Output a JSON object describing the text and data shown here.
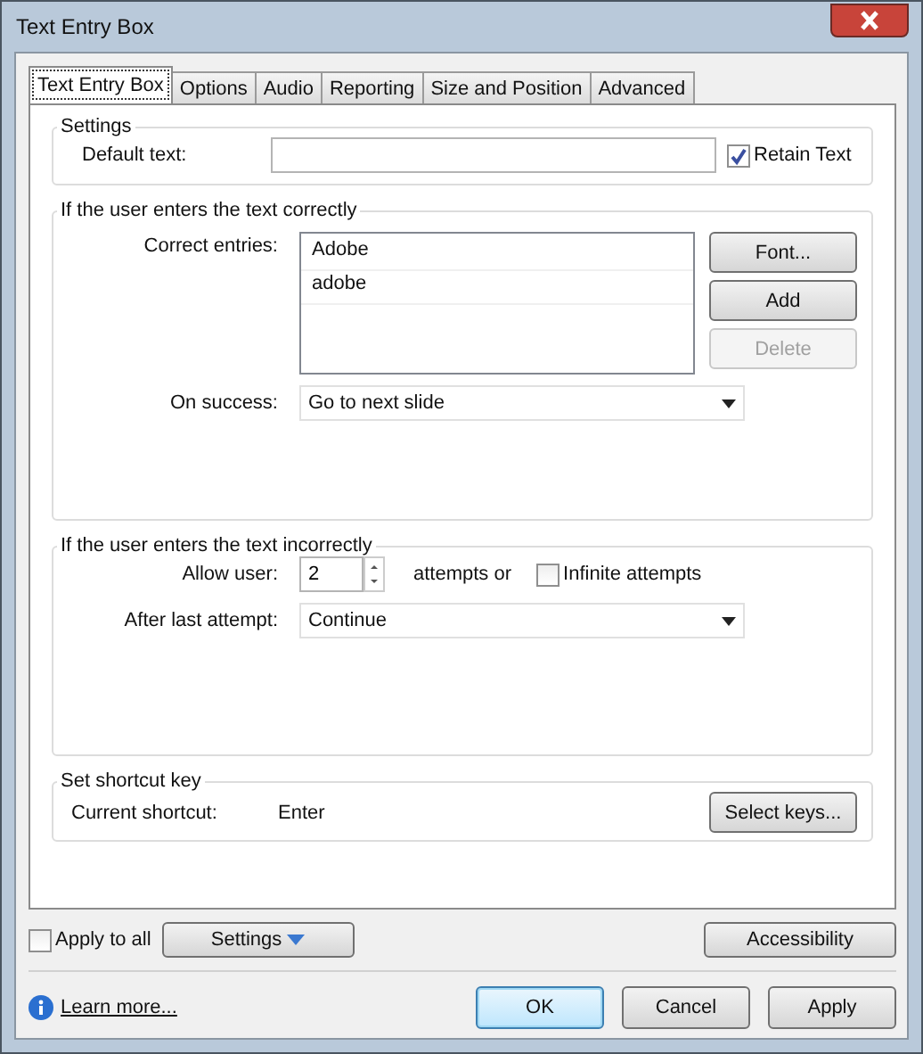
{
  "window": {
    "title": "Text Entry Box"
  },
  "tabs": [
    {
      "label": "Text Entry Box",
      "selected": true
    },
    {
      "label": "Options",
      "selected": false
    },
    {
      "label": "Audio",
      "selected": false
    },
    {
      "label": "Reporting",
      "selected": false
    },
    {
      "label": "Size and Position",
      "selected": false
    },
    {
      "label": "Advanced",
      "selected": false
    }
  ],
  "settings": {
    "legend": "Settings",
    "default_text_label": "Default text:",
    "retain_text": {
      "label": "Retain Text",
      "checked": true
    }
  },
  "correct": {
    "legend": "If the user enters the text correctly",
    "entries_label": "Correct entries:",
    "entries": [
      "Adobe",
      "adobe"
    ],
    "buttons": [
      {
        "label": "Font...",
        "disabled": false
      },
      {
        "label": "Add",
        "disabled": false
      },
      {
        "label": "Delete",
        "disabled": true
      }
    ],
    "on_success_label": "On success:",
    "on_success": "Go to next slide"
  },
  "incorrect": {
    "legend": "If the user enters the text incorrectly",
    "allow_label": "Allow user:",
    "attempts": "2",
    "attempts_suffix": "attempts or",
    "infinite": {
      "label": "Infinite attempts",
      "checked": false
    },
    "after_label": "After last attempt:",
    "after": "Continue"
  },
  "shortcut": {
    "legend": "Set shortcut key",
    "label": "Current shortcut:",
    "value": "Enter",
    "button": "Select keys..."
  },
  "apply_to_all": {
    "label": "Apply to all",
    "checked": false
  },
  "settings_button": "Settings",
  "accessibility_button": "Accessibility",
  "learn_more": "Learn more...",
  "footer_buttons": [
    {
      "label": "OK",
      "selected": true
    },
    {
      "label": "Cancel",
      "selected": false
    },
    {
      "label": "Apply",
      "selected": false
    }
  ]
}
